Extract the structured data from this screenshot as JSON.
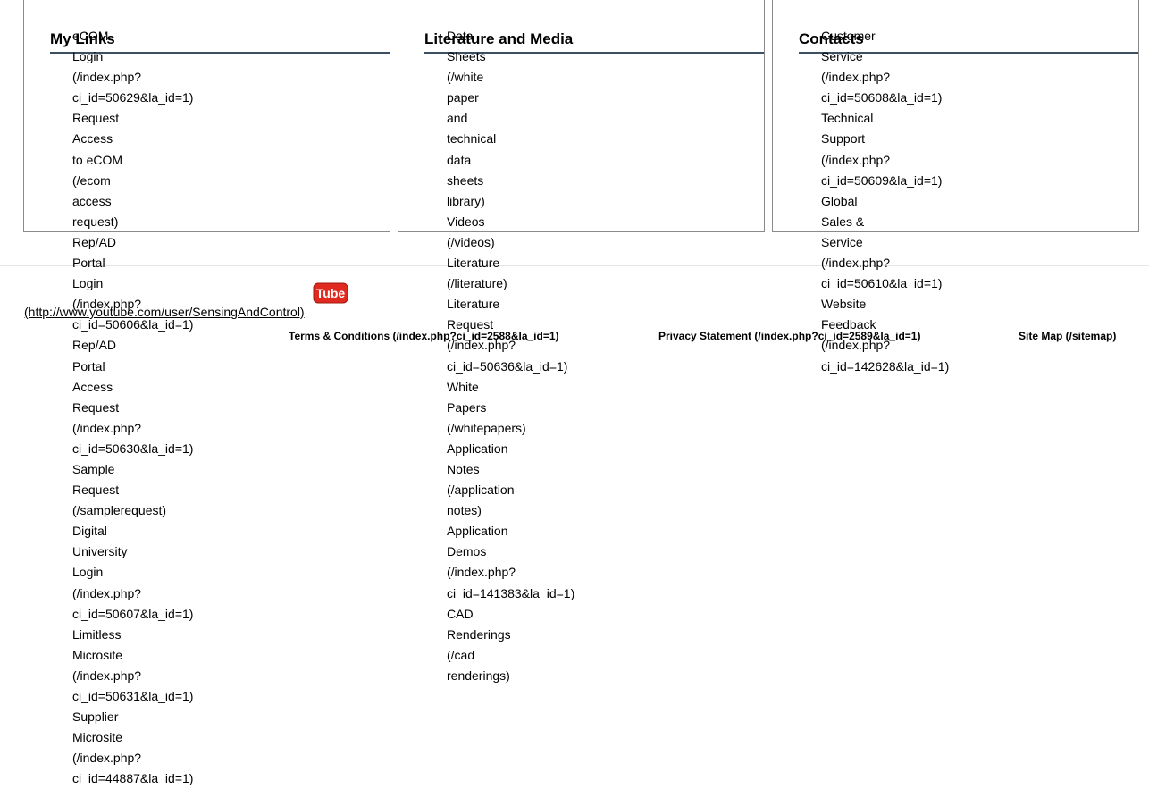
{
  "columns": [
    {
      "title": "My Links",
      "links": [
        "eCOM Login (/index.php? ci_id=50629&la_id=1)",
        "Request Access to eCOM (/ecom access request)",
        "Rep/AD Portal Login (/index.php? ci_id=50606&la_id=1)",
        "Rep/AD Portal Access Request (/index.php? ci_id=50630&la_id=1)",
        "Sample Request (/samplerequest)",
        "Digital University Login (/index.php? ci_id=50607&la_id=1)",
        "Limitless Microsite (/index.php? ci_id=50631&la_id=1)",
        "Supplier Microsite (/index.php? ci_id=44887&la_id=1)"
      ]
    },
    {
      "title": "Literature and Media",
      "links": [
        "Data Sheets (/white paper and technical data sheets library)",
        "Videos (/videos)",
        "Literature (/literature)",
        "Literature Request (/index.php? ci_id=50636&la_id=1)",
        "White Papers (/whitepapers)",
        "Application Notes (/application notes)",
        "Application Demos (/index.php? ci_id=141383&la_id=1)",
        "CAD Renderings (/cad renderings)"
      ]
    },
    {
      "title": "Contacts",
      "links": [
        "Customer Service (/index.php? ci_id=50608&la_id=1)",
        "Technical Support (/index.php? ci_id=50609&la_id=1)",
        "Global Sales & Service (/index.php? ci_id=50610&la_id=1)",
        "Website Feedback (/index.php? ci_id=142628&la_id=1)"
      ]
    }
  ],
  "footer": {
    "youtube_icon_text": "Tube",
    "youtube_link": "(http://www.youtube.com/user/SensingAndControl)",
    "terms": "Terms & Conditions (/index.php?ci_id=2588&la_id=1)",
    "privacy": "Privacy Statement (/index.php?ci_id=2589&la_id=1)",
    "sitemap": "Site Map (/sitemap)"
  },
  "colors": {
    "rule": "#3d4f63",
    "box_border": "#8a8a8a",
    "youtube_red": "#e02a20"
  }
}
